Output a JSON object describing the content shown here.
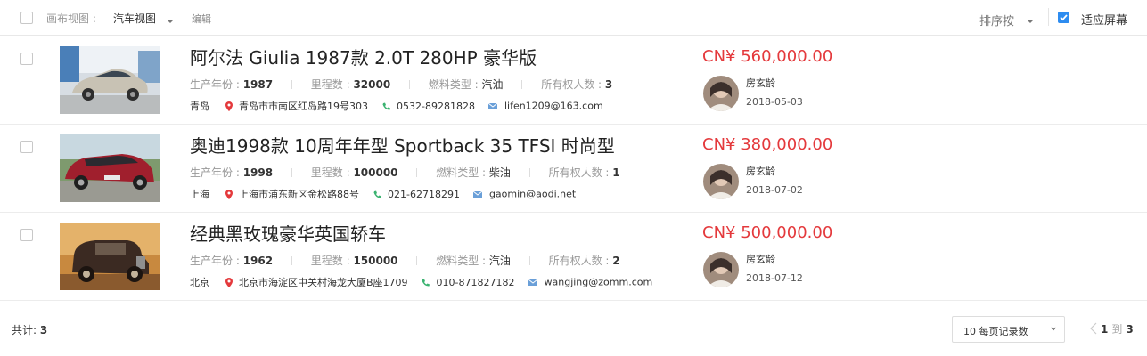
{
  "toolbar": {
    "view_label": "画布视图 :",
    "view_value": "汽车视图",
    "edit_label": "编辑",
    "sort_label": "排序按",
    "fit_label": "适应屏幕",
    "fit_checked": true
  },
  "rows": [
    {
      "title": "阿尔法 Giulia 1987款 2.0T 280HP 豪华版",
      "year_label": "生产年份 :",
      "year": "1987",
      "mileage_label": "里程数 :",
      "mileage": "32000",
      "fuel_label": "燃料类型 :",
      "fuel": "汽油",
      "owners_label": "所有权人数 :",
      "owners": "3",
      "city": "青岛",
      "address": "青岛市市南区红岛路19号303",
      "phone": "0532-89281828",
      "email": "lifen1209@163.com",
      "price": "CN¥ 560,000.00",
      "owner_name": "房玄龄",
      "date": "2018-05-03"
    },
    {
      "title": "奥迪1998款 10周年年型 Sportback 35 TFSI 时尚型",
      "year_label": "生产年份 :",
      "year": "1998",
      "mileage_label": "里程数 :",
      "mileage": "100000",
      "fuel_label": "燃料类型 :",
      "fuel": "柴油",
      "owners_label": "所有权人数 :",
      "owners": "1",
      "city": "上海",
      "address": "上海市浦东新区金松路88号",
      "phone": "021-62718291",
      "email": "gaomin@aodi.net",
      "price": "CN¥ 380,000.00",
      "owner_name": "房玄龄",
      "date": "2018-07-02"
    },
    {
      "title": "经典黑玫瑰豪华英国轿车",
      "year_label": "生产年份 :",
      "year": "1962",
      "mileage_label": "里程数 :",
      "mileage": "150000",
      "fuel_label": "燃料类型 :",
      "fuel": "汽油",
      "owners_label": "所有权人数 :",
      "owners": "2",
      "city": "北京",
      "address": "北京市海淀区中关村海龙大厦B座1709",
      "phone": "010-871827182",
      "email": "wangjing@zomm.com",
      "price": "CN¥ 500,000.00",
      "owner_name": "房玄龄",
      "date": "2018-07-12"
    }
  ],
  "footer": {
    "total_label": "共计:",
    "total": "3",
    "page_size": "10 每页记录数",
    "current_page": "1",
    "to_label": "到",
    "page_count": "3"
  },
  "colors": {
    "price": "#e4393c",
    "accent": "#2d8cf0",
    "pin": "#e4393c",
    "phone": "#3cb371",
    "mail": "#6a9fd8"
  }
}
